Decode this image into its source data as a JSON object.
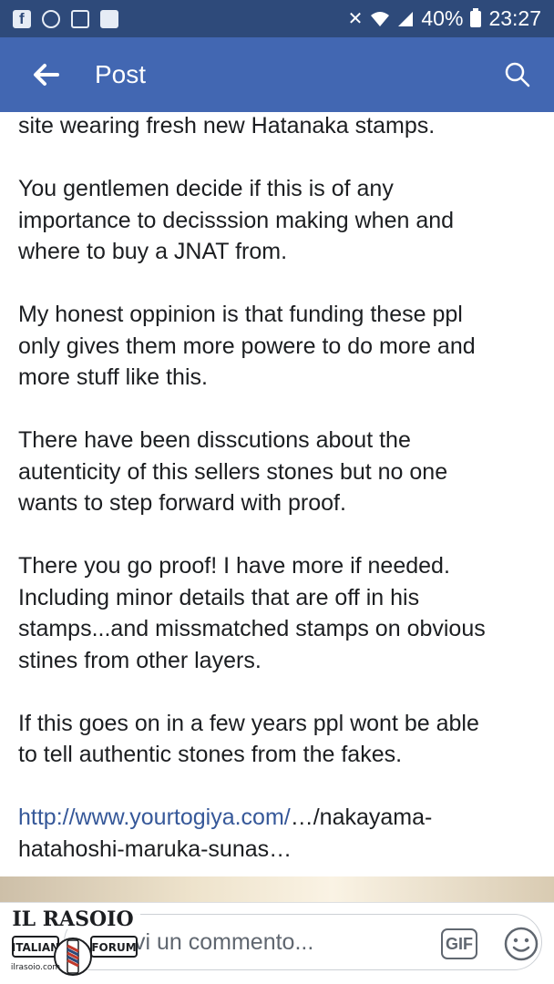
{
  "status_bar": {
    "battery": "40%",
    "time": "23:27"
  },
  "header": {
    "title": "Post"
  },
  "post": {
    "paragraphs": [
      "site wearing fresh new Hatanaka stamps.",
      "You gentlemen decide if this is of any\nimportance to decisssion making when and\nwhere to buy a JNAT from.",
      "My honest oppinion is that funding these ppl\nonly gives them more powere to do more and\nmore stuff like this.",
      "There have been disscutions about the\nautenticity of this sellers stones but no one\nwants to step forward with proof.",
      "There you go proof! I have more if needed.\nIncluding minor details that are off in his\nstamps...and missmatched stamps on obvious\nstines from other layers.",
      "If this goes on in a few years ppl wont be able\nto tell authentic stones from the fakes."
    ],
    "link_primary": "http://www.yourtogiya.com/",
    "link_rest": "…/nakayama-\nhatahoshi-maruka-sunas…"
  },
  "comment_bar": {
    "placeholder": "vi un commento...",
    "gif_label": "GIF"
  },
  "watermark": {
    "title": "IL RASOIO",
    "left": "ITALIAN",
    "right": "FORUM",
    "site": "ilrasoio.com"
  },
  "colors": {
    "status_bar": "#2e4a7a",
    "header": "#4267b2",
    "link": "#365899"
  }
}
